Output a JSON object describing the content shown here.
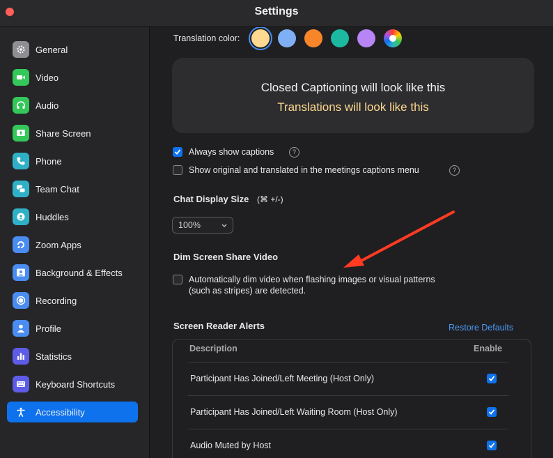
{
  "window": {
    "title": "Settings"
  },
  "sidebar": {
    "items": [
      {
        "label": "General",
        "icon": "gear-icon",
        "color": "#8e8e93"
      },
      {
        "label": "Video",
        "icon": "video-camera-icon",
        "color": "#34c759"
      },
      {
        "label": "Audio",
        "icon": "headphones-icon",
        "color": "#34c759"
      },
      {
        "label": "Share Screen",
        "icon": "share-screen-icon",
        "color": "#34c759"
      },
      {
        "label": "Phone",
        "icon": "phone-icon",
        "color": "#30b0c7"
      },
      {
        "label": "Team Chat",
        "icon": "chat-bubbles-icon",
        "color": "#30b0c7"
      },
      {
        "label": "Huddles",
        "icon": "huddles-icon",
        "color": "#30b0c7"
      },
      {
        "label": "Zoom Apps",
        "icon": "apps-icon",
        "color": "#4a8cf0"
      },
      {
        "label": "Background & Effects",
        "icon": "portrait-icon",
        "color": "#4a8cf0"
      },
      {
        "label": "Recording",
        "icon": "record-icon",
        "color": "#4a8cf0"
      },
      {
        "label": "Profile",
        "icon": "person-icon",
        "color": "#4a8cf0"
      },
      {
        "label": "Statistics",
        "icon": "bar-chart-icon",
        "color": "#5e5ce6"
      },
      {
        "label": "Keyboard Shortcuts",
        "icon": "keyboard-icon",
        "color": "#5e5ce6"
      },
      {
        "label": "Accessibility",
        "icon": "accessibility-icon",
        "color": "#0e72ed",
        "active": true
      }
    ]
  },
  "main": {
    "translation_color_label": "Translation color:",
    "swatches": [
      "#ffd991",
      "#7fb0f5",
      "#f7862a",
      "#1cb8a0",
      "#b785f5",
      "rainbow"
    ],
    "preview": {
      "caption_text": "Closed Captioning will look like this",
      "translation_text": "Translations will look like this",
      "translation_color": "#ffd991"
    },
    "always_show_captions": {
      "label": "Always show captions",
      "checked": true
    },
    "show_original": {
      "label": "Show original and translated in the meetings captions menu",
      "checked": false
    },
    "chat_display": {
      "title": "Chat Display Size",
      "shortcut": "(⌘ +/-)",
      "value": "100%"
    },
    "dim_screen": {
      "title": "Dim Screen Share Video",
      "line1": "Automatically dim video when flashing images or visual patterns",
      "line2": "(such as stripes) are detected.",
      "checked": false
    },
    "screen_reader": {
      "title": "Screen Reader Alerts",
      "restore_label": "Restore Defaults",
      "col_description": "Description",
      "col_enable": "Enable",
      "rows": [
        {
          "label": "Participant Has Joined/Left Meeting (Host Only)",
          "enabled": true
        },
        {
          "label": "Participant Has Joined/Left Waiting Room (Host Only)",
          "enabled": true
        },
        {
          "label": "Audio Muted by Host",
          "enabled": true
        }
      ]
    }
  }
}
